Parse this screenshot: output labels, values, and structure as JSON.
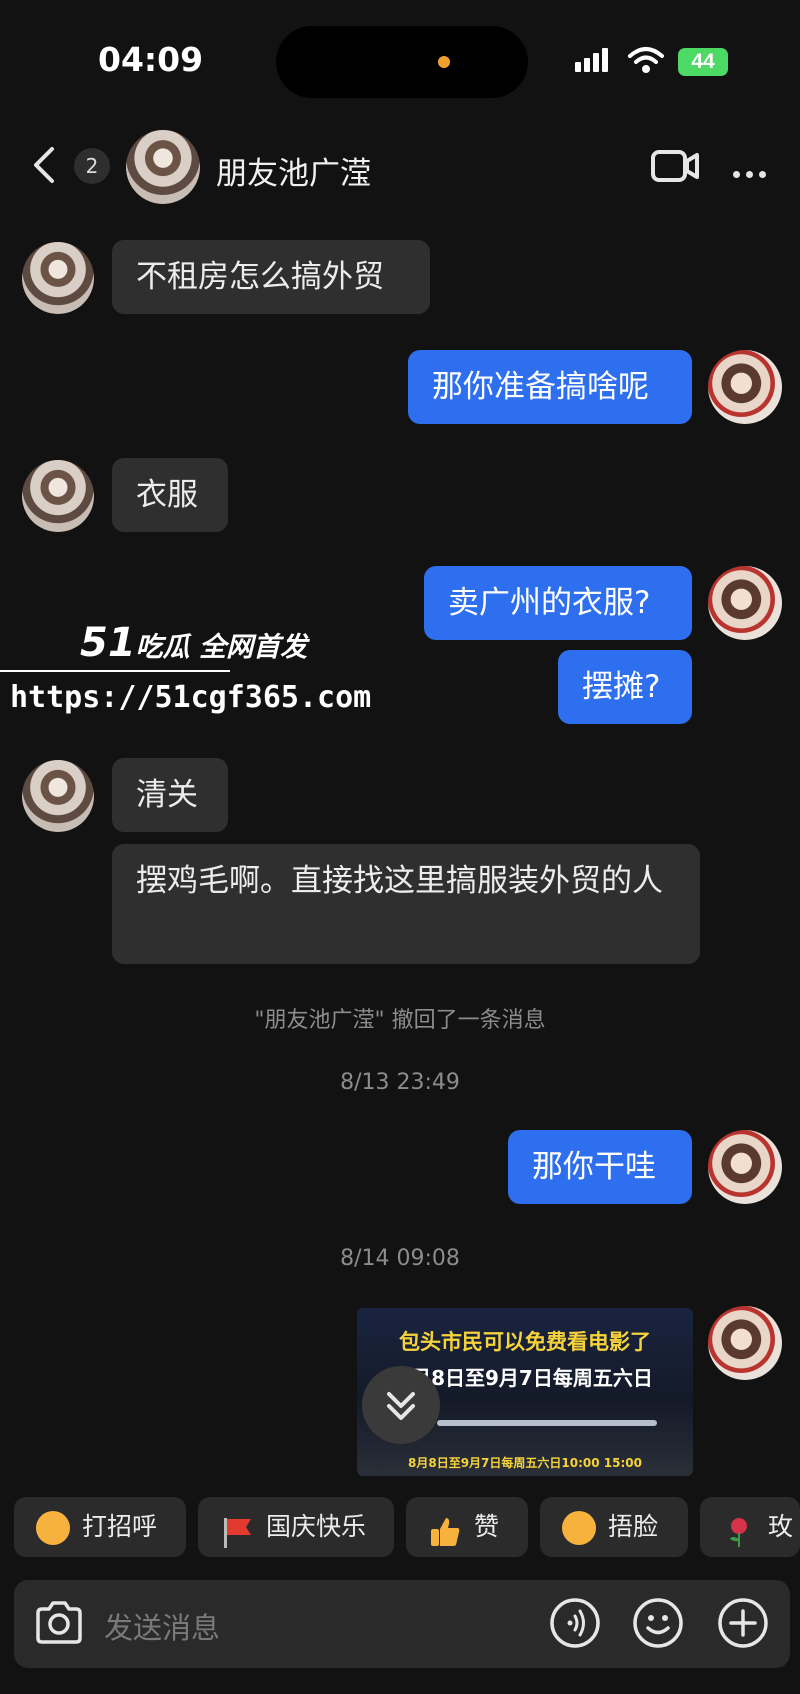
{
  "status_bar": {
    "time": "04:09",
    "battery": "44"
  },
  "header": {
    "back_badge_count": "2",
    "contact_name": "朋友池广滢"
  },
  "messages": [
    {
      "side": "in",
      "text": "不租房怎么搞外贸"
    },
    {
      "side": "out",
      "text": "那你准备搞啥呢"
    },
    {
      "side": "in",
      "text": "衣服"
    },
    {
      "side": "out",
      "text": "卖广州的衣服?"
    },
    {
      "side": "out",
      "text": "摆摊?"
    },
    {
      "side": "in",
      "text": "清关"
    },
    {
      "side": "in",
      "text": "摆鸡毛啊。直接找这里搞服装外贸的人"
    }
  ],
  "system": {
    "recall_notice": "\"朋友池广滢\" 撤回了一条消息",
    "time1": "8/13 23:49",
    "time2": "8/14 09:08"
  },
  "msg_after_time1": {
    "side": "out",
    "text": "那你干哇"
  },
  "image_message": {
    "line1": "包头市民可以免费看电影了",
    "line2": "8月8日至9月7日每周五六日",
    "line3": "8月8日至9月7日每周五六日10:00 15:00"
  },
  "watermark": {
    "brand": "51",
    "slogan": "吃瓜 全网首发",
    "url": "https://51cgf365.com"
  },
  "quick_replies": [
    {
      "label": "打招呼",
      "icon": "smile-emoji-icon",
      "color": "#f6b23c"
    },
    {
      "label": "国庆快乐",
      "icon": "red-flag-icon",
      "color": "#e23a2e"
    },
    {
      "label": "赞",
      "icon": "thumbs-up-icon",
      "color": "#f6b23c"
    },
    {
      "label": "捂脸",
      "icon": "facepalm-emoji-icon",
      "color": "#f6b23c"
    },
    {
      "label": "玫",
      "icon": "rose-icon",
      "color": "#d6334a"
    }
  ],
  "input": {
    "placeholder": "发送消息"
  },
  "colors": {
    "background": "#121212",
    "bubble_in": "#2f2f2f",
    "bubble_out": "#2e6ff0"
  }
}
